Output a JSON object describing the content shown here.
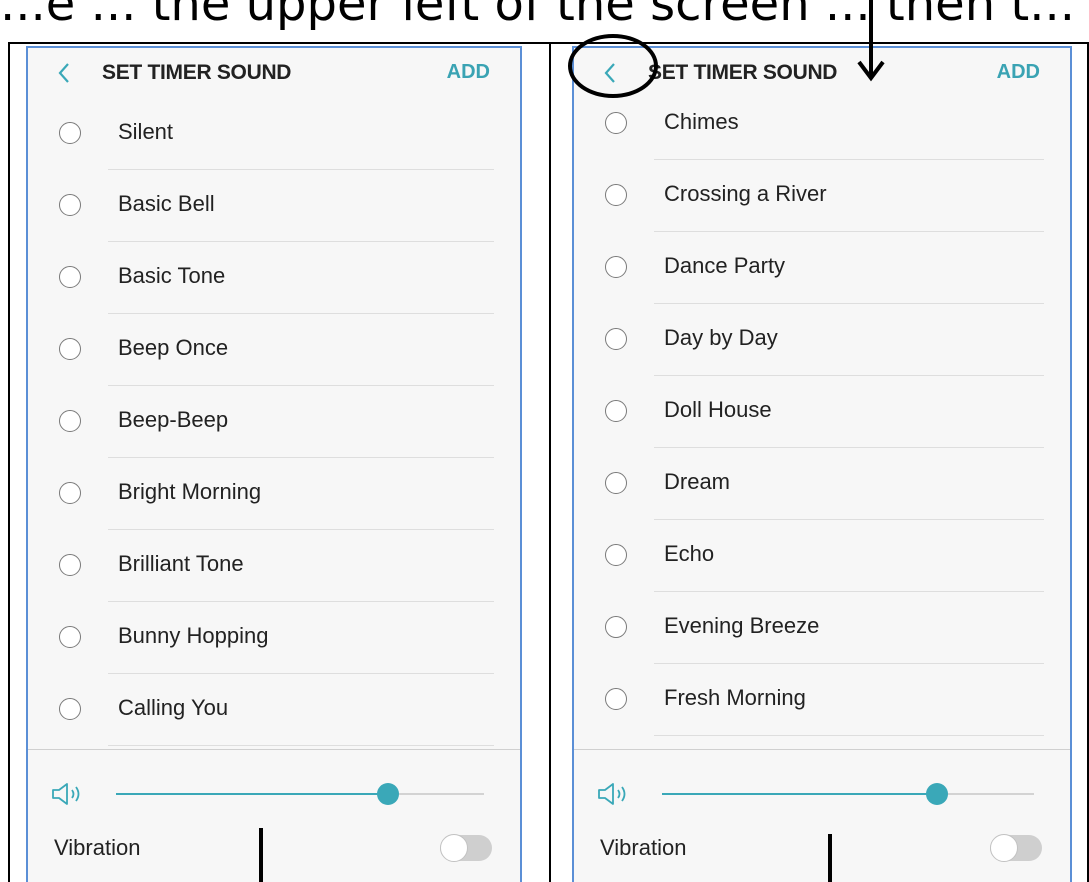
{
  "colors": {
    "accent": "#3aa8b8",
    "add_text": "#3aa3b3",
    "phone_border": "#5b8fd6",
    "background": "#f7f7f7"
  },
  "caption": "...e ... the upper left of the screen ... then t...",
  "left_screen": {
    "header": {
      "back_icon": "chevron-left-icon",
      "title": "SET TIMER SOUND",
      "add": "ADD"
    },
    "items": [
      {
        "label": "Silent"
      },
      {
        "label": "Basic Bell"
      },
      {
        "label": "Basic Tone"
      },
      {
        "label": "Beep Once"
      },
      {
        "label": "Beep-Beep"
      },
      {
        "label": "Bright Morning"
      },
      {
        "label": "Brilliant Tone"
      },
      {
        "label": "Bunny Hopping"
      },
      {
        "label": "Calling You"
      }
    ],
    "volume": {
      "icon": "speaker-icon",
      "level": 0.74
    },
    "vibration": {
      "label": "Vibration",
      "on": false
    }
  },
  "right_screen": {
    "header": {
      "back_icon": "chevron-left-icon",
      "title": "SET TIMER SOUND",
      "add": "ADD"
    },
    "items": [
      {
        "label": "Chimes"
      },
      {
        "label": "Crossing a River"
      },
      {
        "label": "Dance Party"
      },
      {
        "label": "Day by Day"
      },
      {
        "label": "Doll House"
      },
      {
        "label": "Dream"
      },
      {
        "label": "Echo"
      },
      {
        "label": "Evening Breeze"
      },
      {
        "label": "Fresh Morning"
      }
    ],
    "volume": {
      "icon": "speaker-icon",
      "level": 0.74
    },
    "vibration": {
      "label": "Vibration",
      "on": false
    }
  }
}
